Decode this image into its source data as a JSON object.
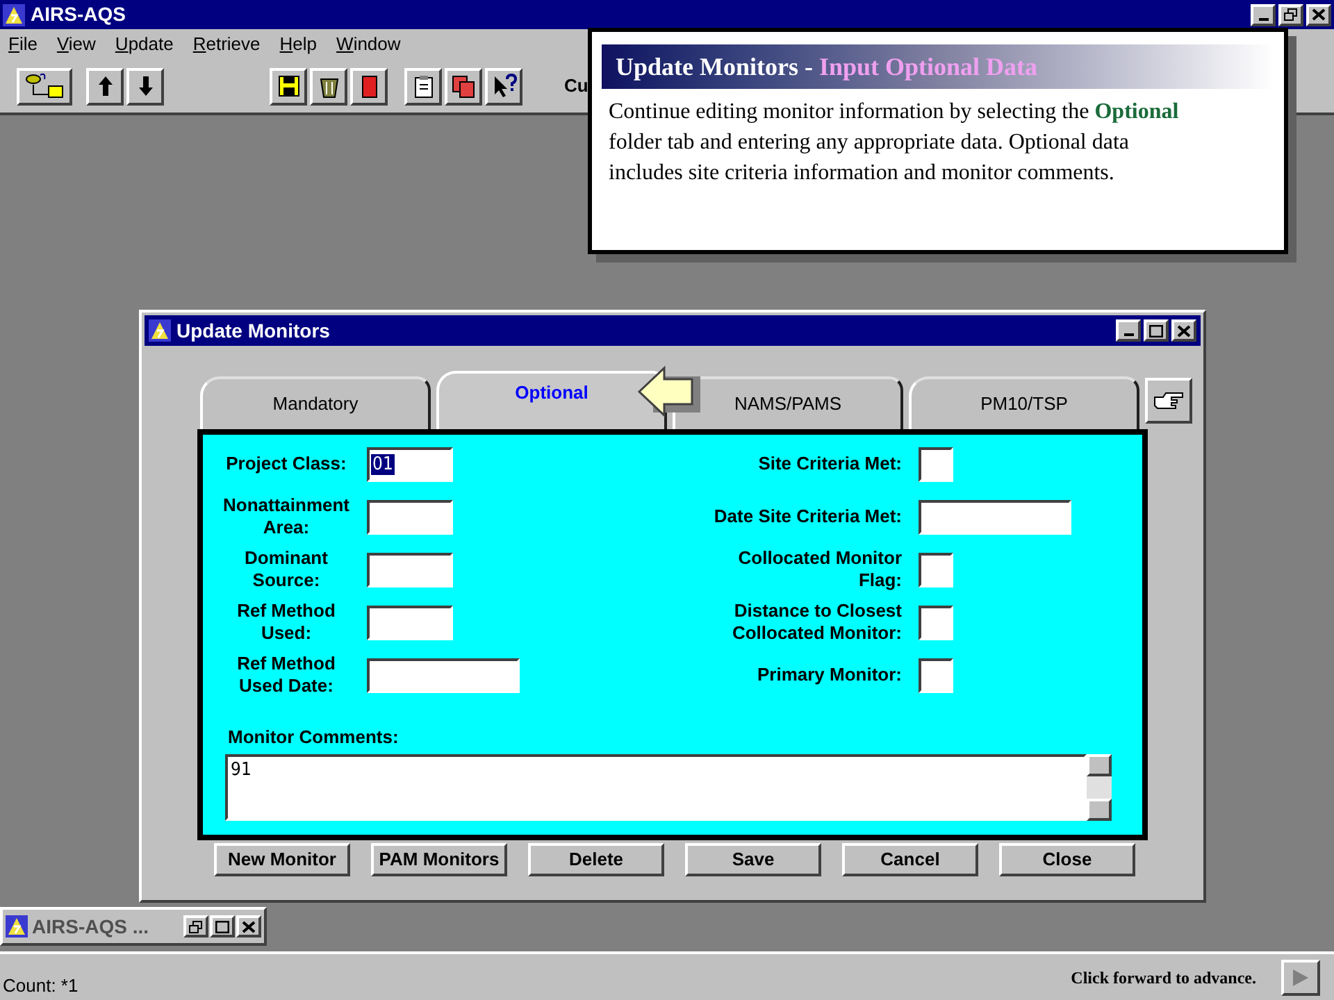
{
  "app_window": {
    "title": "AIRS-AQS"
  },
  "menu": [
    "File",
    "View",
    "Update",
    "Retrieve",
    "Help",
    "Window"
  ],
  "toolbar": {
    "trailing_text": "Cu"
  },
  "callout": {
    "title": "Update Monitors - ",
    "subtitle": "Input Optional Data",
    "body": "Continue editing monitor information by selecting the **Optional** folder tab and entering any appropriate data. Optional data includes site criteria information and monitor comments."
  },
  "dialog": {
    "title": "Update Monitors",
    "tabs": [
      {
        "label": "Mandatory",
        "selected": false
      },
      {
        "label": "Optional",
        "selected": true
      },
      {
        "label": "NAMS/PAMS",
        "selected": false
      },
      {
        "label": "PM10/TSP",
        "selected": false
      }
    ],
    "fields_left": [
      {
        "label": "Project Class:",
        "value": "01",
        "kind": "text"
      },
      {
        "label": "Nonattainment Area:",
        "kind": "text"
      },
      {
        "label": "Dominant Source:",
        "kind": "text"
      },
      {
        "label": "Ref Method Used:",
        "kind": "text"
      },
      {
        "label": "Ref Method Used Date:",
        "kind": "date"
      }
    ],
    "fields_right": [
      {
        "label": "Site Criteria Met:",
        "kind": "flag"
      },
      {
        "label": "Date Site Criteria Met:",
        "kind": "date"
      },
      {
        "label": "Collocated Monitor Flag:",
        "kind": "flag"
      },
      {
        "label": "Distance to Closest Collocated Monitor:",
        "kind": "flag"
      },
      {
        "label": "Primary Monitor:",
        "kind": "flag"
      }
    ],
    "comments": {
      "label": "Monitor Comments:",
      "value": "91"
    },
    "buttons": [
      "New Monitor",
      "PAM Monitors",
      "Delete",
      "Save",
      "Cancel",
      "Close"
    ]
  },
  "minimized_window": {
    "title": "AIRS-AQS ..."
  },
  "status_bar": {
    "count": "Count: *1",
    "hint": "Click forward to advance."
  }
}
